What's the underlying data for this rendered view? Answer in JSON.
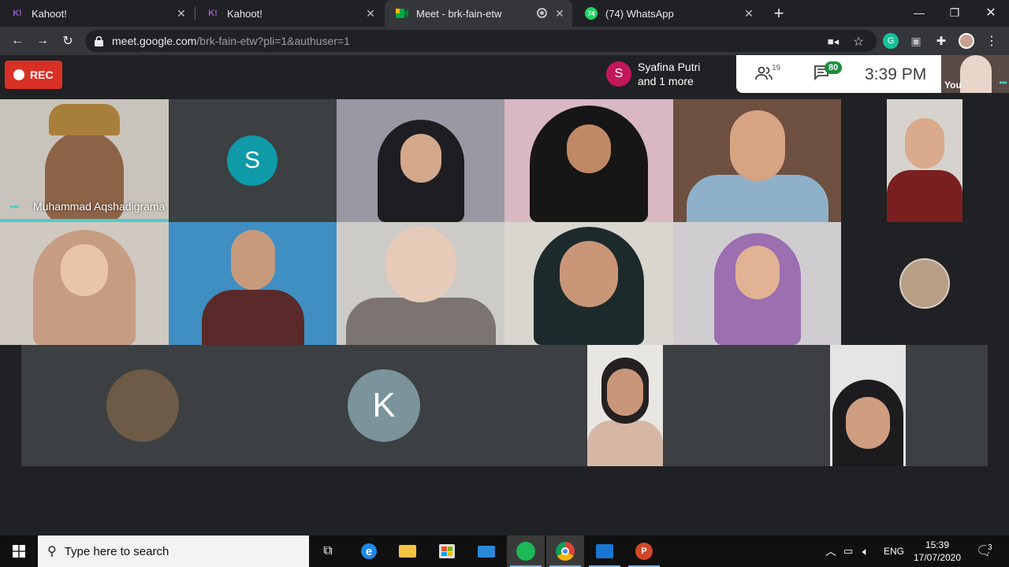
{
  "browser": {
    "tabs": [
      {
        "title": "Kahoot!",
        "favicon": "K!"
      },
      {
        "title": "Kahoot!",
        "favicon": "K!"
      },
      {
        "title": "Meet - brk-fain-etw",
        "favicon": "meet-icon"
      },
      {
        "title": "(74) WhatsApp",
        "favicon": "74"
      }
    ],
    "url_host": "meet.google.com",
    "url_path": "/brk-fain-etw?pli=1&authuser=1"
  },
  "meet": {
    "rec_label": "REC",
    "presenter": {
      "initial": "S",
      "line1": "Syafina Putri",
      "line2": "and 1 more"
    },
    "participants_count": "19",
    "chat_count": "80",
    "time": "3:39  PM",
    "self_label": "You",
    "active_speaker": "Muhammad Aqshadigrama",
    "avatar_s": "S",
    "avatar_k": "K"
  },
  "taskbar": {
    "search_placeholder": "Type here to search",
    "lang": "ENG",
    "time": "15:39",
    "date": "17/07/2020",
    "notifications": "3"
  },
  "colors": {
    "rec": "#d93025",
    "speaking": "#4ecdc4",
    "avatar_s": "#0f9aa8",
    "avatar_k": "#7b939b",
    "presenter_avatar": "#c2185b"
  }
}
